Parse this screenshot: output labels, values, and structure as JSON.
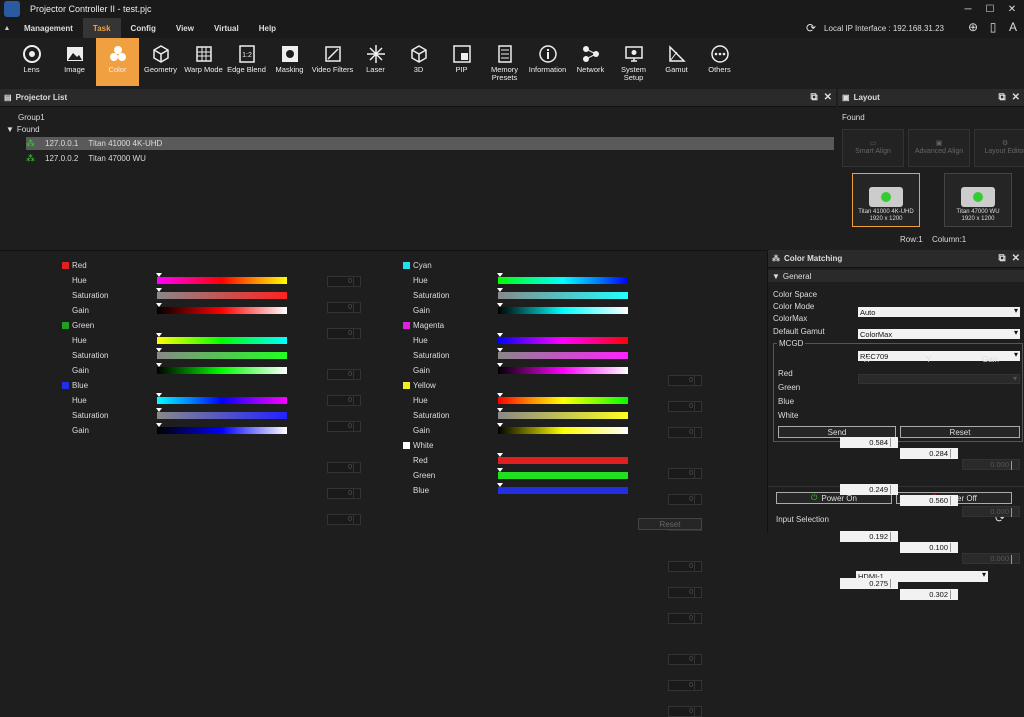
{
  "window": {
    "title": "Projector Controller II - test.pjc"
  },
  "menu": {
    "items": [
      "Management",
      "Task",
      "Config",
      "View",
      "Virtual",
      "Help"
    ],
    "active": "Task"
  },
  "header": {
    "ip_label": "Local IP Interface : 192.168.31.23"
  },
  "toolbar": {
    "active": "Color",
    "items": [
      {
        "label": "Lens",
        "icon": "lens-icon"
      },
      {
        "label": "Image",
        "icon": "image-icon"
      },
      {
        "label": "Color",
        "icon": "color-icon"
      },
      {
        "label": "Geometry",
        "icon": "geometry-icon"
      },
      {
        "label": "Warp Mode",
        "icon": "warp-icon"
      },
      {
        "label": "Edge Blend",
        "icon": "edge-blend-icon"
      },
      {
        "label": "Masking",
        "icon": "masking-icon"
      },
      {
        "label": "Video Filters",
        "icon": "video-filters-icon"
      },
      {
        "label": "Laser",
        "icon": "laser-icon"
      },
      {
        "label": "3D",
        "icon": "3d-icon"
      },
      {
        "label": "PIP",
        "icon": "pip-icon"
      },
      {
        "label": "Memory Presets",
        "icon": "memory-icon"
      },
      {
        "label": "Information",
        "icon": "info-icon"
      },
      {
        "label": "Network",
        "icon": "network-icon"
      },
      {
        "label": "System Setup",
        "icon": "system-icon"
      },
      {
        "label": "Gamut",
        "icon": "gamut-icon"
      },
      {
        "label": "Others",
        "icon": "others-icon"
      }
    ]
  },
  "projector_list": {
    "title": "Projector List",
    "group": "Group1",
    "found_label": "Found",
    "projectors": [
      {
        "ip": "127.0.0.1",
        "model": "Titan 41000 4K-UHD",
        "selected": true
      },
      {
        "ip": "127.0.0.2",
        "model": "Titan 47000 WU",
        "selected": false
      }
    ]
  },
  "layout": {
    "title": "Layout",
    "found_label": "Found",
    "buttons": [
      "Smart Align",
      "Advanced Align",
      "Layout Editor"
    ],
    "cards": [
      {
        "name": "Titan 41000 4K-UHD",
        "res": "1920 x 1200"
      },
      {
        "name": "Titan 47000 WU",
        "res": "1920 x 1200"
      }
    ],
    "row_label": "Row:1",
    "column_label": "Column:1"
  },
  "color_controls": {
    "left": [
      {
        "name": "Red",
        "swatch": "#e02020",
        "rows": [
          "Hue",
          "Saturation",
          "Gain"
        ],
        "values": [
          "0",
          "0",
          "0"
        ]
      },
      {
        "name": "Green",
        "swatch": "#20a020",
        "rows": [
          "Hue",
          "Saturation",
          "Gain"
        ],
        "values": [
          "0",
          "0",
          "0"
        ]
      },
      {
        "name": "Blue",
        "swatch": "#2030e0",
        "rows": [
          "Hue",
          "Saturation",
          "Gain"
        ],
        "values": [
          "0",
          "0",
          "0"
        ]
      }
    ],
    "right": [
      {
        "name": "Cyan",
        "swatch": "#20e0f0",
        "rows": [
          "Hue",
          "Saturation",
          "Gain"
        ],
        "values": [
          "0",
          "0",
          "0"
        ]
      },
      {
        "name": "Magenta",
        "swatch": "#e020e0",
        "rows": [
          "Hue",
          "Saturation",
          "Gain"
        ],
        "values": [
          "0",
          "0",
          "0"
        ]
      },
      {
        "name": "Yellow",
        "swatch": "#f0f020",
        "rows": [
          "Hue",
          "Saturation",
          "Gain"
        ],
        "values": [
          "0",
          "0",
          "0"
        ]
      },
      {
        "name": "White",
        "swatch": "#ffffff",
        "rows": [
          "Red",
          "Green",
          "Blue"
        ],
        "values": [
          "0",
          "0",
          "0"
        ]
      }
    ],
    "reset_label": "Reset"
  },
  "color_matching": {
    "title": "Color Matching",
    "general_label": "General",
    "color_space_label": "Color Space",
    "color_space": "Auto",
    "color_mode_label": "Color Mode",
    "color_mode": "ColorMax",
    "colormax_label": "ColorMax",
    "colormax": "REC709",
    "default_gamut_label": "Default Gamut",
    "default_gamut": "",
    "mcgd_label": "MCGD",
    "col_x": "X",
    "col_y": "Y",
    "col_gain": "Gain",
    "rows": [
      {
        "label": "Red",
        "x": "0.584",
        "y": "0.284",
        "gain": "0.000"
      },
      {
        "label": "Green",
        "x": "0.249",
        "y": "0.560",
        "gain": "0.000"
      },
      {
        "label": "Blue",
        "x": "0.192",
        "y": "0.100",
        "gain": "0.000"
      },
      {
        "label": "White",
        "x": "0.275",
        "y": "0.302",
        "gain": ""
      }
    ],
    "send_label": "Send",
    "reset_label": "Reset",
    "power_on_label": "Power On",
    "power_off_label": "Power Off",
    "input_selection_label": "Input Selection",
    "input_selection": "HDMI-1"
  }
}
